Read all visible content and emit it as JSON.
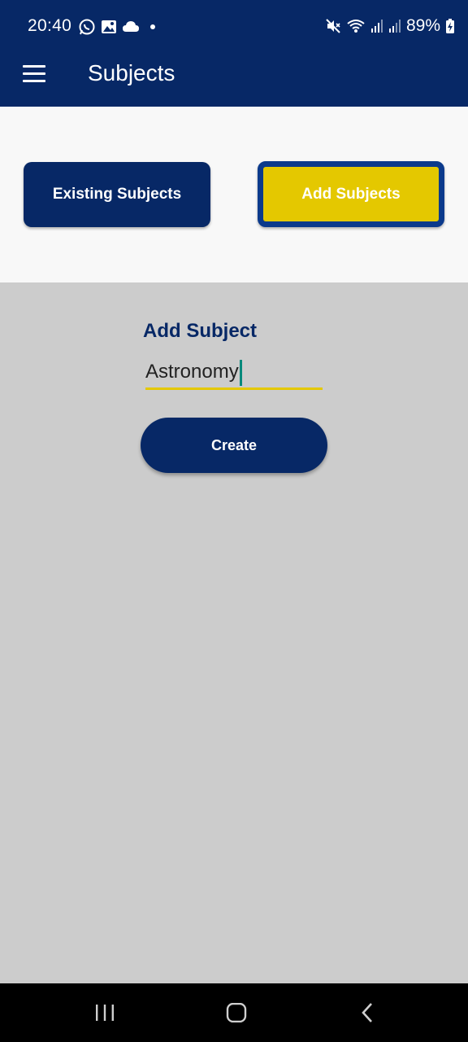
{
  "status_bar": {
    "time": "20:40",
    "battery": "89%",
    "icons": [
      "whatsapp-icon",
      "image-icon",
      "cloud-icon",
      "dot-icon",
      "mute-icon",
      "wifi-icon",
      "signal-icon",
      "signal-icon",
      "battery-charging-icon"
    ]
  },
  "app_bar": {
    "title": "Subjects",
    "menu_icon": "menu-icon"
  },
  "toggle": {
    "existing_label": "Existing Subjects",
    "add_label": "Add Subjects"
  },
  "form": {
    "label": "Add Subject",
    "input_value": "Astronomy",
    "create_label": "Create"
  },
  "nav_bar": {
    "icons": [
      "recents-icon",
      "home-icon",
      "back-icon"
    ]
  },
  "colors": {
    "primary": "#072866",
    "accent": "#e4c800",
    "selected_border": "#0b3a8c",
    "background": "#cccccc"
  }
}
